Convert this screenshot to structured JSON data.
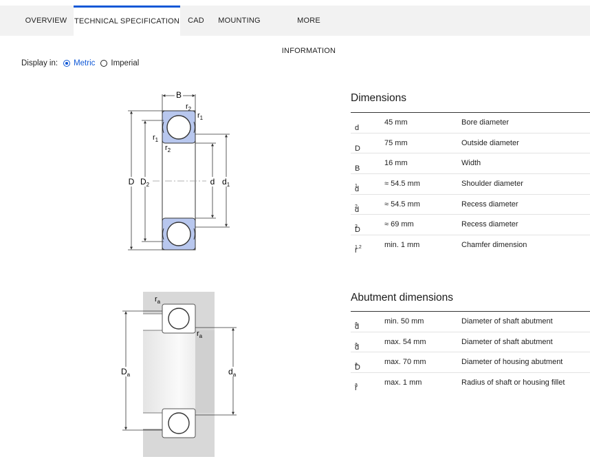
{
  "tabs": [
    {
      "label": "OVERVIEW",
      "active": false
    },
    {
      "label": "TECHNICAL SPECIFICATION",
      "active": true
    },
    {
      "label": "CAD",
      "active": false
    },
    {
      "label": "MOUNTING",
      "active": false
    },
    {
      "label": "MORE INFORMATION",
      "active": false
    }
  ],
  "display": {
    "label": "Display in:",
    "options": [
      {
        "label": "Metric",
        "selected": true
      },
      {
        "label": "Imperial",
        "selected": false
      }
    ]
  },
  "colors": {
    "accent": "#0f58d6",
    "shield": "#b8c7ee"
  },
  "drawing1": {
    "labels": {
      "B": "B",
      "r2_top": "r",
      "r2_top_sub": "2",
      "r1_top": "r",
      "r1_top_sub": "1",
      "r1_left": "r",
      "r1_left_sub": "1",
      "r2_left": "r",
      "r2_left_sub": "2",
      "D": "D",
      "D2": "D",
      "D2_sub": "2",
      "d": "d",
      "d1": "d",
      "d1_sub": "1"
    }
  },
  "drawing2": {
    "labels": {
      "ra_top": "r",
      "ra_top_sub": "a",
      "ra_mid": "r",
      "ra_mid_sub": "a",
      "Da": "D",
      "Da_sub": "a",
      "da": "d",
      "da_sub": "a"
    }
  },
  "dimensions": {
    "title": "Dimensions",
    "rows": [
      {
        "sym": "d",
        "sub": "",
        "value": "45 mm",
        "desc": "Bore diameter"
      },
      {
        "sym": "D",
        "sub": "",
        "value": "75 mm",
        "desc": "Outside diameter"
      },
      {
        "sym": "B",
        "sub": "",
        "value": "16 mm",
        "desc": "Width"
      },
      {
        "sym": "d",
        "sub": "1",
        "value": "≈ 54.5 mm",
        "desc": "Shoulder diameter"
      },
      {
        "sym": "d",
        "sub": "2",
        "value": "≈ 54.5 mm",
        "desc": "Recess diameter"
      },
      {
        "sym": "D",
        "sub": "2",
        "value": "≈ 69 mm",
        "desc": "Recess diameter"
      },
      {
        "sym": "r",
        "sub": "1,2",
        "value": "min. 1 mm",
        "desc": "Chamfer dimension"
      }
    ]
  },
  "abutment": {
    "title": "Abutment dimensions",
    "rows": [
      {
        "sym": "d",
        "sub": "a",
        "value": "min. 50 mm",
        "desc": "Diameter of shaft abutment"
      },
      {
        "sym": "d",
        "sub": "a",
        "value": "max. 54 mm",
        "desc": "Diameter of shaft abutment"
      },
      {
        "sym": "D",
        "sub": "a",
        "value": "max. 70 mm",
        "desc": "Diameter of housing abutment"
      },
      {
        "sym": "r",
        "sub": "a",
        "value": "max. 1 mm",
        "desc": "Radius of shaft or housing fillet"
      }
    ]
  }
}
